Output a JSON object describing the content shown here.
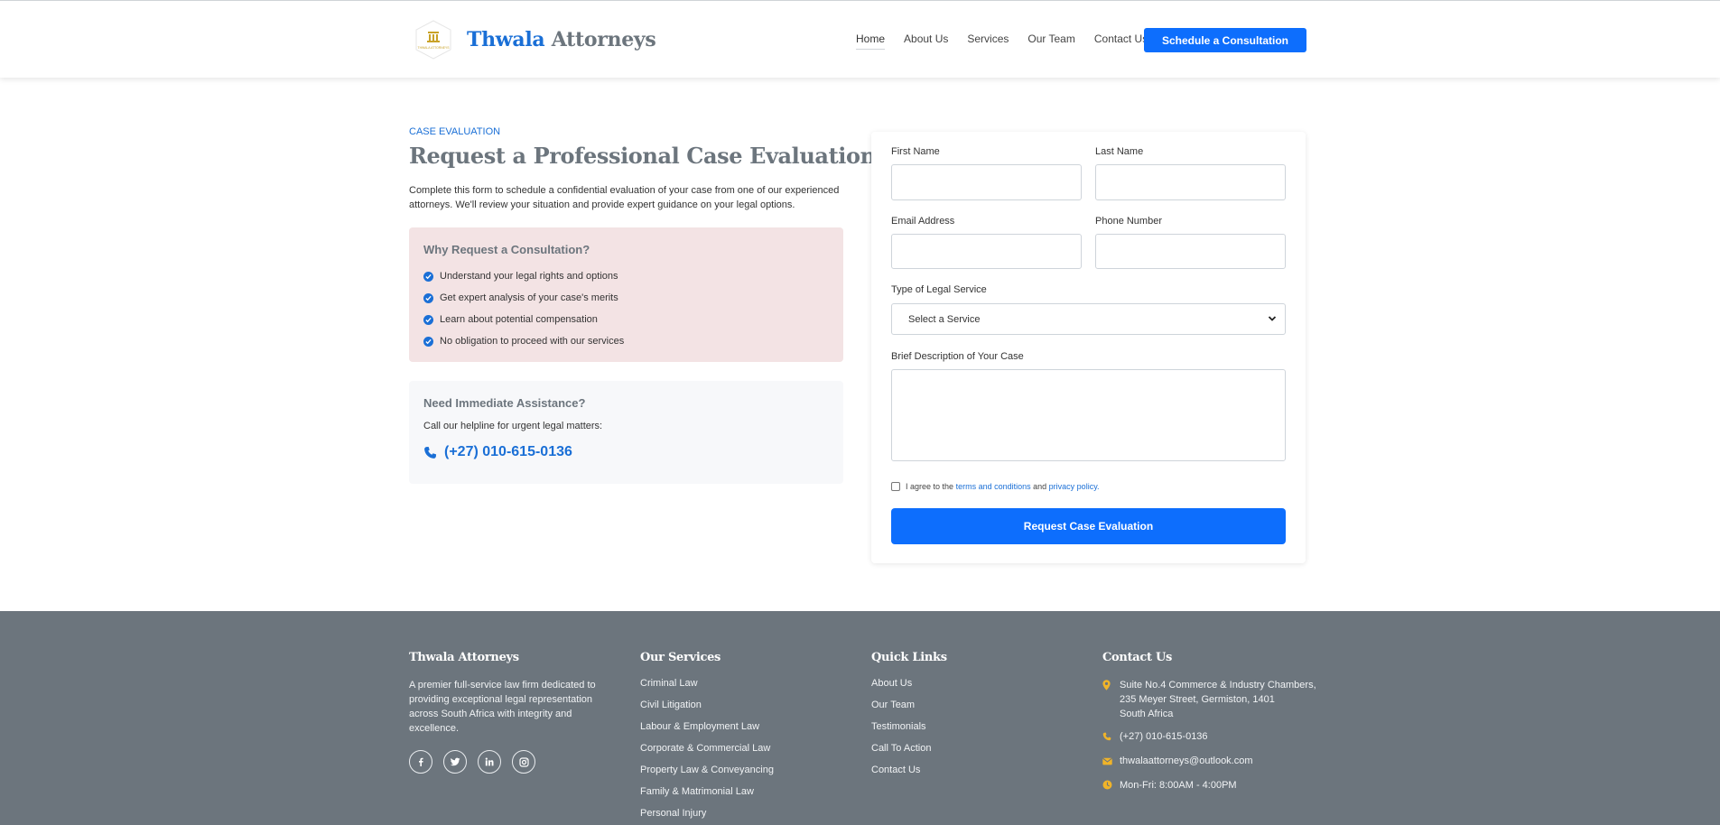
{
  "brand": {
    "name_part1": "Thwala",
    "name_part2": "Attorneys",
    "logo_caption": "THWALA ATTORNEYS"
  },
  "nav": {
    "items": [
      "Home",
      "About Us",
      "Services",
      "Our Team",
      "Contact Us"
    ],
    "cta_label": "Schedule a Consultation"
  },
  "hero": {
    "eyebrow": "CASE EVALUATION",
    "title": "Request a Professional Case Evaluation",
    "intro": "Complete this form to schedule a confidential evaluation of your case from one of our experienced attorneys. We'll review your situation and provide expert guidance on your legal options."
  },
  "why": {
    "title": "Why Request a Consultation?",
    "items": [
      "Understand your legal rights and options",
      "Get expert analysis of your case's merits",
      "Learn about potential compensation",
      "No obligation to proceed with our services"
    ]
  },
  "assist": {
    "title": "Need Immediate Assistance?",
    "text": "Call our helpline for urgent legal matters:",
    "phone": "(+27) 010-615-0136"
  },
  "form": {
    "first_name_label": "First Name",
    "first_name_value": "",
    "last_name_label": "Last Name",
    "last_name_value": "",
    "email_label": "Email Address",
    "email_value": "",
    "phone_label": "Phone Number",
    "phone_value": "",
    "service_label": "Type of Legal Service",
    "service_selected": "Select a Service",
    "description_label": "Brief Description of Your Case",
    "description_value": "",
    "agree_prefix": "I agree to the",
    "agree_terms": "terms and conditions",
    "agree_and": "and",
    "agree_privacy": "privacy policy.",
    "agree_checked": false,
    "submit_label": "Request Case Evaluation"
  },
  "footer": {
    "about": {
      "title": "Thwala Attorneys",
      "text": "A premier full-service law firm dedicated to providing exceptional legal representation across South Africa with integrity and excellence."
    },
    "social_icons": [
      "facebook-icon",
      "twitter-icon",
      "linkedin-icon",
      "instagram-icon"
    ],
    "services": {
      "title": "Our Services",
      "items": [
        "Criminal Law",
        "Civil Litigation",
        "Labour & Employment Law",
        "Corporate & Commercial Law",
        "Property Law & Conveyancing",
        "Family & Matrimonial Law",
        "Personal Injury"
      ]
    },
    "quick_links": {
      "title": "Quick Links",
      "items": [
        "About Us",
        "Our Team",
        "Testimonials",
        "Call To Action",
        "Contact Us"
      ]
    },
    "contact": {
      "title": "Contact Us",
      "address_lines": [
        "Suite No.4 Commerce & Industry Chambers,",
        "235 Meyer Street, Germiston, 1401",
        "South Africa"
      ],
      "phone": "(+27) 010-615-0136",
      "email": "thwalaattorneys@outlook.com",
      "hours": "Mon-Fri: 8:00AM - 4:00PM"
    }
  },
  "colors": {
    "primary": "#0d6efd",
    "link_blue": "#1a6fd6",
    "muted_gray": "#6c757d",
    "pink_panel": "#f3e3e4",
    "light_panel": "#f7f8fa",
    "footer_bg": "#6c757d",
    "footer_icon_gold": "#f0b429"
  }
}
